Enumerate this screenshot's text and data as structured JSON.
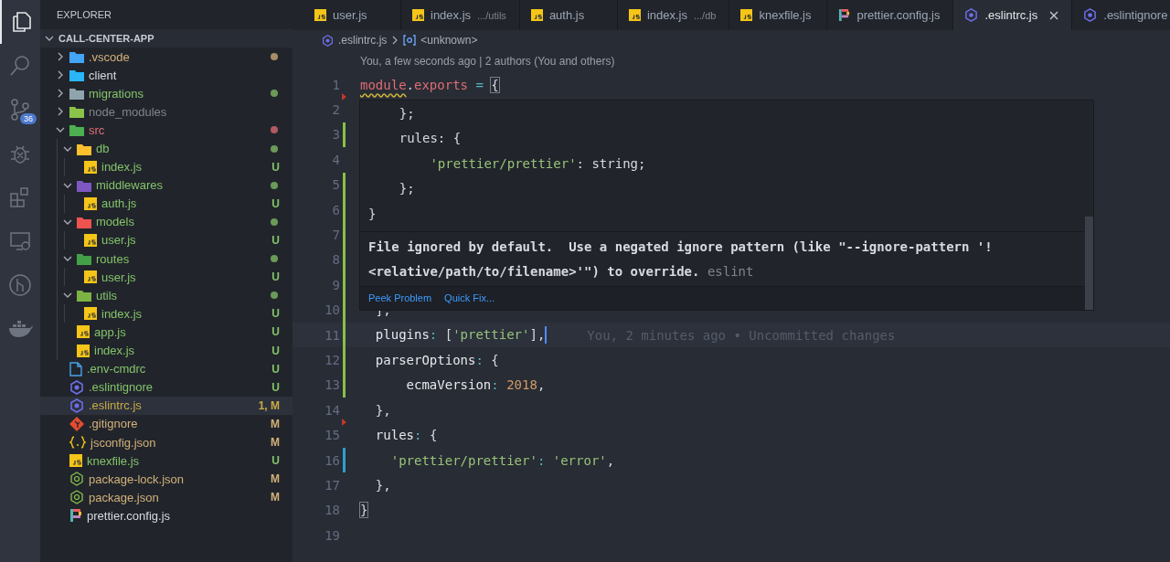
{
  "activity_bar": {
    "items": [
      {
        "kind": "files",
        "selected": true
      },
      {
        "kind": "search",
        "selected": false
      },
      {
        "kind": "source-control",
        "selected": false,
        "badge": "36"
      },
      {
        "kind": "debug",
        "selected": false
      },
      {
        "kind": "extensions",
        "selected": false
      },
      {
        "kind": "remote",
        "selected": false
      },
      {
        "kind": "git-graph",
        "selected": false
      },
      {
        "kind": "docker",
        "selected": false
      }
    ]
  },
  "sidebar": {
    "title": "EXPLORER",
    "project": {
      "name": "CALL-CENTER-APP",
      "expanded": true
    },
    "tree": [
      {
        "name": ".vscode",
        "kind": "vscode",
        "color": "#d3b07a",
        "dot": true,
        "expanded": false,
        "selected": false
      },
      {
        "name": "client",
        "kind": "client",
        "color": "#d7dae0",
        "expanded": false,
        "selected": false
      },
      {
        "name": "migrations",
        "kind": "migrations",
        "color": "#84c26a",
        "dot": true,
        "expanded": false,
        "selected": false
      },
      {
        "name": "node_modules",
        "kind": "node",
        "color": "#7f848e",
        "expanded": false,
        "selected": false
      },
      {
        "name": "src",
        "kind": "src",
        "color": "#e06c75",
        "dot": true,
        "expanded": true,
        "selected": false,
        "children": [
          {
            "name": "db",
            "kind": "db",
            "color": "#84c26a",
            "dot": true,
            "expanded": true,
            "selected": false,
            "children": [
              {
                "name": "index.js",
                "kind": "js",
                "color": "#84c26a",
                "badge": "U",
                "selected": false
              }
            ]
          },
          {
            "name": "middlewares",
            "kind": "middleware",
            "color": "#84c26a",
            "dot": true,
            "expanded": true,
            "selected": false,
            "children": [
              {
                "name": "auth.js",
                "kind": "js",
                "color": "#84c26a",
                "badge": "U",
                "selected": false
              }
            ]
          },
          {
            "name": "models",
            "kind": "models",
            "color": "#84c26a",
            "dot": true,
            "expanded": true,
            "selected": false,
            "children": [
              {
                "name": "user.js",
                "kind": "js",
                "color": "#84c26a",
                "badge": "U",
                "selected": false
              }
            ]
          },
          {
            "name": "routes",
            "kind": "routes",
            "color": "#84c26a",
            "dot": true,
            "expanded": true,
            "selected": false,
            "children": [
              {
                "name": "user.js",
                "kind": "js",
                "color": "#84c26a",
                "badge": "U",
                "selected": false
              }
            ]
          },
          {
            "name": "utils",
            "kind": "utils",
            "color": "#84c26a",
            "dot": true,
            "expanded": true,
            "selected": false,
            "children": [
              {
                "name": "index.js",
                "kind": "js",
                "color": "#84c26a",
                "badge": "U",
                "selected": false
              }
            ]
          },
          {
            "name": "app.js",
            "kind": "js",
            "color": "#84c26a",
            "badge": "U",
            "selected": false
          },
          {
            "name": "index.js",
            "kind": "js",
            "color": "#84c26a",
            "badge": "U",
            "selected": false
          }
        ]
      },
      {
        "name": ".env-cmdrc",
        "kind": "doc",
        "color": "#84c26a",
        "badge": "U",
        "selected": false
      },
      {
        "name": ".eslintignore",
        "kind": "eslint",
        "color": "#84c26a",
        "badge": "U",
        "selected": false
      },
      {
        "name": ".eslintrc.js",
        "kind": "eslint",
        "color": "#c9ab46",
        "badge": "1, M",
        "selected": true
      },
      {
        "name": ".gitignore",
        "kind": "git",
        "color": "#d3b07a",
        "badge": "M",
        "selected": false
      },
      {
        "name": "jsconfig.json",
        "kind": "braces",
        "color": "#d3b07a",
        "badge": "M",
        "selected": false
      },
      {
        "name": "knexfile.js",
        "kind": "js",
        "color": "#84c26a",
        "badge": "U",
        "selected": false
      },
      {
        "name": "package-lock.json",
        "kind": "npm",
        "color": "#d3b07a",
        "badge": "M",
        "selected": false
      },
      {
        "name": "package.json",
        "kind": "npm",
        "color": "#d3b07a",
        "badge": "M",
        "selected": false
      },
      {
        "name": "prettier.config.js",
        "kind": "prettier",
        "color": "#d7dae0",
        "selected": false
      }
    ]
  },
  "tabs": [
    {
      "label": "user.js",
      "kind": "js",
      "selected": false
    },
    {
      "label": "index.js",
      "detail": ".../utils",
      "kind": "js",
      "selected": false
    },
    {
      "label": "auth.js",
      "kind": "js",
      "selected": false
    },
    {
      "label": "index.js",
      "detail": ".../db",
      "kind": "js",
      "selected": false
    },
    {
      "label": "knexfile.js",
      "kind": "js",
      "selected": false
    },
    {
      "label": "prettier.config.js",
      "kind": "prettier",
      "selected": false
    },
    {
      "label": ".eslintrc.js",
      "kind": "eslint",
      "selected": true
    },
    {
      "label": ".eslintignore",
      "kind": "eslint",
      "selected": false
    }
  ],
  "breadcrumb": [
    {
      "label": ".eslintrc.js",
      "kind": "eslint"
    },
    {
      "label": "<unknown>",
      "kind": "symbol"
    }
  ],
  "codelens": "You, a few seconds ago | 2 authors (You and others)",
  "editor": {
    "lines": [
      {
        "n": "1",
        "kind": "deleted",
        "tokens": [
          {
            "t": "module",
            "kind": "var",
            "warn": true
          },
          {
            "t": ".",
            "kind": "plain"
          },
          {
            "t": "exports",
            "kind": "var"
          },
          {
            "t": " = ",
            "kind": "op"
          },
          {
            "t": "{",
            "kind": "plain",
            "match": true
          }
        ]
      },
      {
        "n": "2",
        "kind": "none"
      },
      {
        "n": "3",
        "kind": "added"
      },
      {
        "n": "4",
        "kind": "none"
      },
      {
        "n": "5",
        "kind": "added"
      },
      {
        "n": "6",
        "kind": "added"
      },
      {
        "n": "7",
        "kind": "added"
      },
      {
        "n": "8",
        "kind": "added"
      },
      {
        "n": "9",
        "kind": "added"
      },
      {
        "n": "10",
        "kind": "added",
        "tokens": [
          {
            "t": "  ],",
            "kind": "plain"
          }
        ]
      },
      {
        "n": "11",
        "kind": "added",
        "current": true,
        "blame": "You, 2 minutes ago • Uncommitted changes",
        "tokens": [
          {
            "t": "  plugins",
            "kind": "prop"
          },
          {
            "t": ": ",
            "kind": "op"
          },
          {
            "t": "[",
            "kind": "plain"
          },
          {
            "t": "'prettier'",
            "kind": "str"
          },
          {
            "t": "],",
            "kind": "plain"
          }
        ]
      },
      {
        "n": "12",
        "kind": "added",
        "tokens": [
          {
            "t": "  parserOptions",
            "kind": "prop"
          },
          {
            "t": ": ",
            "kind": "op"
          },
          {
            "t": "{",
            "kind": "plain"
          }
        ]
      },
      {
        "n": "13",
        "kind": "added",
        "tokens": [
          {
            "t": "      ecmaVersion",
            "kind": "prop"
          },
          {
            "t": ": ",
            "kind": "op"
          },
          {
            "t": "2018",
            "kind": "num"
          },
          {
            "t": ",",
            "kind": "plain"
          }
        ]
      },
      {
        "n": "14",
        "kind": "deleted",
        "tokens": [
          {
            "t": "  },",
            "kind": "plain"
          }
        ]
      },
      {
        "n": "15",
        "kind": "none",
        "tokens": [
          {
            "t": "  rules",
            "kind": "prop"
          },
          {
            "t": ": ",
            "kind": "op"
          },
          {
            "t": "{",
            "kind": "plain"
          }
        ]
      },
      {
        "n": "16",
        "kind": "modified",
        "tokens": [
          {
            "t": "    'prettier/prettier'",
            "kind": "str"
          },
          {
            "t": ": ",
            "kind": "op"
          },
          {
            "t": "'error'",
            "kind": "str"
          },
          {
            "t": ",",
            "kind": "plain"
          }
        ]
      },
      {
        "n": "17",
        "kind": "none",
        "tokens": [
          {
            "t": "  },",
            "kind": "plain"
          }
        ]
      },
      {
        "n": "18",
        "kind": "none",
        "tokens": [
          {
            "t": "}",
            "kind": "plain",
            "match": true
          }
        ]
      },
      {
        "n": "19",
        "kind": "none"
      }
    ]
  },
  "hover": {
    "code": [
      [
        {
          "t": "    };",
          "kind": "plain"
        }
      ],
      [
        {
          "t": "    rules: {",
          "kind": "plain"
        }
      ],
      [
        {
          "t": "        'prettier/prettier'",
          "kind": "str"
        },
        {
          "t": ": string;",
          "kind": "plain"
        }
      ],
      [
        {
          "t": "    };",
          "kind": "plain"
        }
      ],
      [
        {
          "t": "}",
          "kind": "plain"
        }
      ]
    ],
    "message": "File ignored by default.  Use a negated ignore pattern (like \"--ignore-pattern '!<relative/path/to/filename>'\") to override.",
    "source": "eslint",
    "actions": [
      "Peek Problem",
      "Quick Fix..."
    ]
  }
}
